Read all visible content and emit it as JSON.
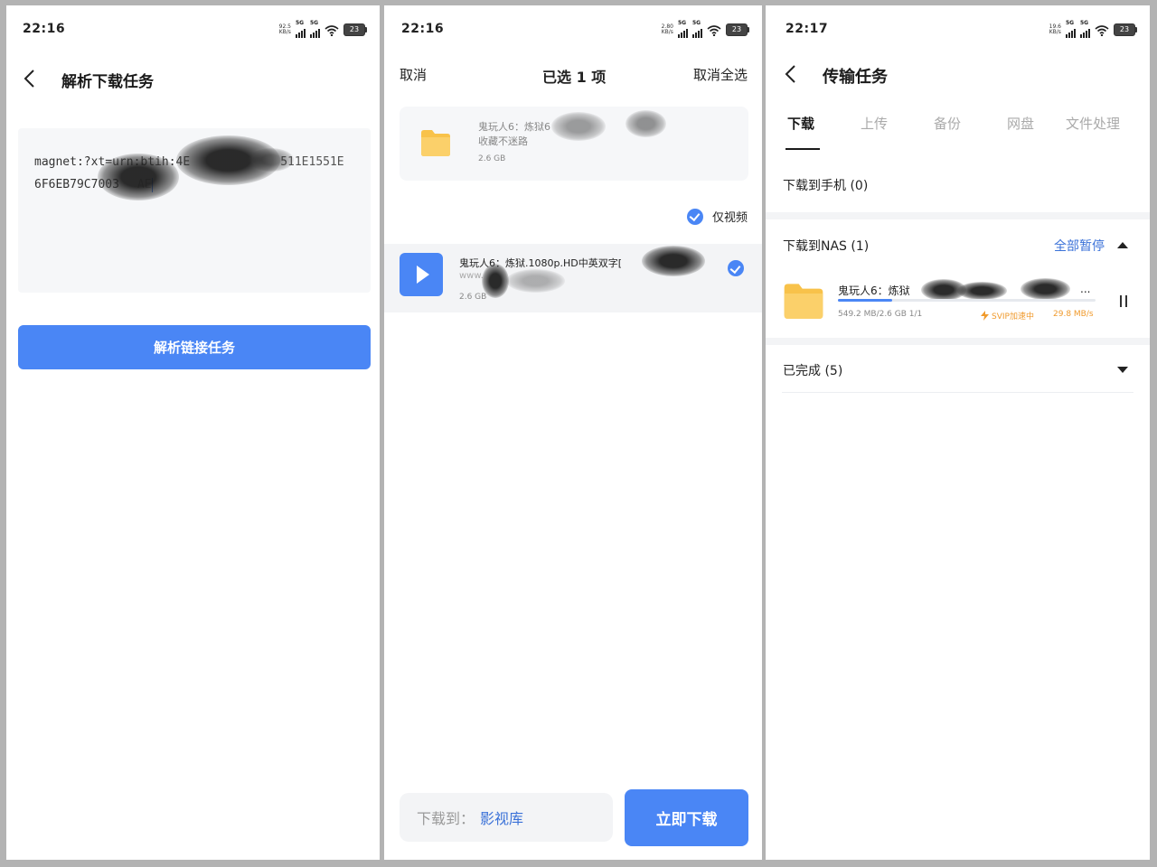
{
  "panel1": {
    "status": {
      "time": "22:16",
      "netspeed_value": "92.5",
      "netspeed_unit": "KB/s",
      "battery": "23"
    },
    "title": "解析下载任务",
    "link_text": "magnet:?xt=urn:btih:4E...511E1551E6F6EB79C7003...AE",
    "link_line1": "magnet:?xt=urn:btih:4E",
    "link_line1_tail": "511E1551E",
    "link_line2": "6F6EB79C7003",
    "link_line2_tail": "AE",
    "parse_button": "解析链接任务"
  },
  "panel2": {
    "status": {
      "time": "22:16",
      "netspeed_value": "2.80",
      "netspeed_unit": "KB/s",
      "battery": "23"
    },
    "cancel": "取消",
    "selected": "已选 1 项",
    "deselect_all": "取消全选",
    "folder": {
      "name_line1": "鬼玩人6：炼狱6",
      "name_line2": "收藏不迷路",
      "size": "2.6 GB"
    },
    "filter_label": "仅视频",
    "file": {
      "name_line1": "鬼玩人6：炼狱.1080p.HD中英双字[",
      "name_line2": "www.",
      "size": "2.6 GB"
    },
    "dest_label": "下载到：",
    "dest_value": "影视库",
    "download_button": "立即下载"
  },
  "panel3": {
    "status": {
      "time": "22:17",
      "netspeed_value": "19.6",
      "netspeed_unit": "KB/s",
      "battery": "23"
    },
    "title": "传输任务",
    "tabs": [
      "下载",
      "上传",
      "备份",
      "网盘",
      "文件处理"
    ],
    "active_tab": "下载",
    "to_phone": "下载到手机 (0)",
    "to_nas": "下载到NAS (1)",
    "pause_all": "全部暂停",
    "task": {
      "name": "鬼玩人6：炼狱",
      "ellipsis": "...",
      "meta": "549.2 MB/2.6 GB   1/1",
      "svip": "SVIP加速中",
      "speed": "29.8 MB/s",
      "progress": 0.21
    },
    "completed": "已完成 (5)"
  },
  "colors": {
    "accent": "#4a86f5",
    "link": "#3b72d8",
    "svip": "#f09a2c",
    "folder": "#f8c24a"
  }
}
